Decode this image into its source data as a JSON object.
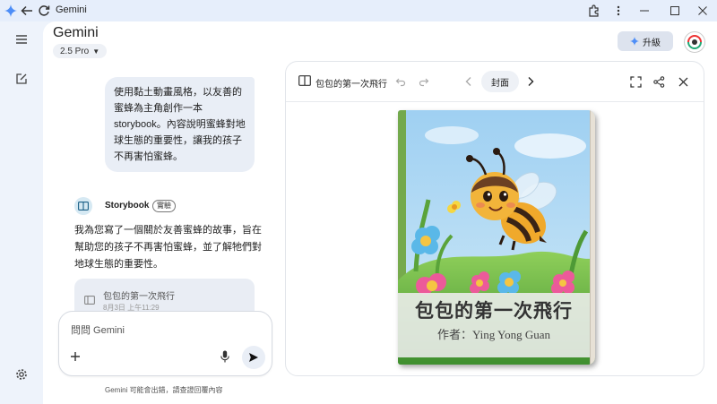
{
  "window": {
    "title": "Gemini"
  },
  "header": {
    "app_title": "Gemini",
    "model": "2.5 Pro",
    "upgrade_label": "升級"
  },
  "chat": {
    "user_message": "使用黏土動畫風格，以友善的蜜蜂為主角創作一本 storybook。內容說明蜜蜂對地球生態的重要性，讓我的孩子不再害怕蜜蜂。",
    "assistant_name": "Storybook",
    "assistant_badge": "實驗",
    "assistant_reply": "我為您寫了一個關於友善蜜蜂的故事，旨在幫助您的孩子不再害怕蜜蜂，並了解牠們對地球生態的重要性。",
    "story_card": {
      "title": "包包的第一次飛行",
      "subtitle": "8月3日 上午11:29"
    },
    "input_placeholder": "問問 Gemini",
    "disclaimer": "Gemini 可能會出錯，請查證回覆內容"
  },
  "panel": {
    "title": "包包的第一次飛行",
    "current_page": "封面"
  },
  "book": {
    "title": "包包的第一次飛行",
    "author": "作者：Ying Yong Guan"
  },
  "icons": {
    "window": [
      "sparkle-icon",
      "back-arrow-icon",
      "reload-icon",
      "extension-icon",
      "more-vert-icon",
      "minimize-icon",
      "maximize-icon",
      "close-icon"
    ],
    "rail": [
      "menu-icon",
      "new-chat-icon",
      "settings-icon"
    ],
    "panel": [
      "book-icon",
      "undo-icon",
      "redo-icon",
      "prev-page-icon",
      "next-page-icon",
      "fullscreen-icon",
      "share-icon",
      "close-icon"
    ]
  },
  "colors": {
    "accent": "#1a73e8",
    "background": "#eef3fb",
    "card": "#e9eef6"
  }
}
